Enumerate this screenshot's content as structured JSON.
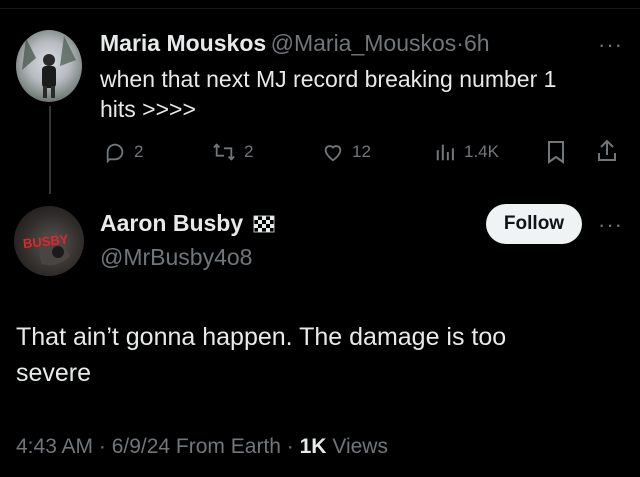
{
  "reply_parent": {
    "author_name": "Maria Mouskos",
    "handle": "@Maria_Mouskos",
    "separator": "·",
    "time": "6h",
    "text_line1": "when that next MJ record breaking number 1",
    "text_line2": "hits >>>>",
    "metrics": {
      "replies": "2",
      "reposts": "2",
      "likes": "12",
      "views": "1.4K"
    },
    "more_label": "···"
  },
  "main_tweet": {
    "author_name": "Aaron Busby",
    "author_badge": "🏁",
    "handle": "@MrBusby4o8",
    "avatar_text": "BUSBY",
    "follow_label": "Follow",
    "more_label": "···",
    "text_line1": "That ain’t gonna happen.  The damage is too",
    "text_line2": "severe",
    "timestamp": "4:43 AM · 6/9/24 From Earth · ",
    "views_count": "1K",
    "views_label": " Views"
  },
  "colors": {
    "background": "#000000",
    "text": "#e7e9ea",
    "muted": "#71767b",
    "follow_bg": "#eff3f4"
  },
  "icons": [
    "reply-icon",
    "repost-icon",
    "like-icon",
    "views-icon",
    "bookmark-icon",
    "share-icon"
  ]
}
